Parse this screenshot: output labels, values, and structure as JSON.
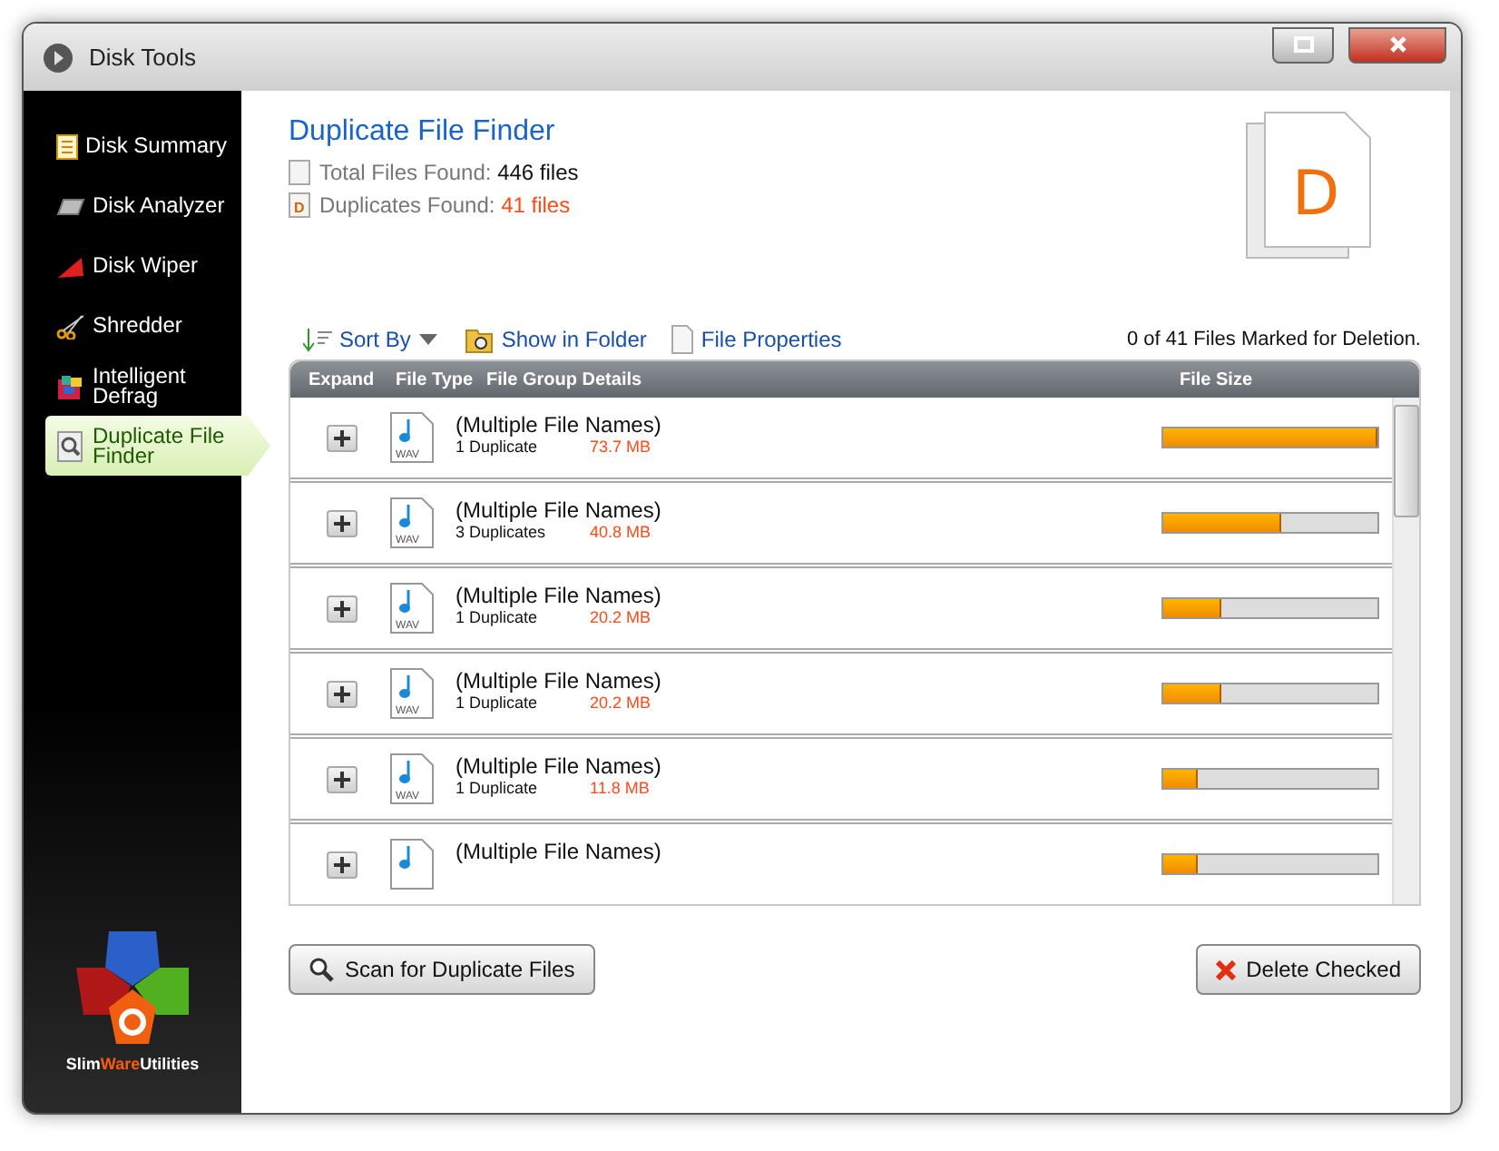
{
  "window": {
    "title": "Disk Tools"
  },
  "sidebar": {
    "items": [
      {
        "label": "Disk Summary",
        "kind": "summary",
        "selected": false
      },
      {
        "label": "Disk Analyzer",
        "kind": "analyzer",
        "selected": false
      },
      {
        "label": "Disk Wiper",
        "kind": "wiper",
        "selected": false
      },
      {
        "label": "Shredder",
        "kind": "shredder",
        "selected": false
      },
      {
        "label": "Intelligent Defrag",
        "kind": "defrag",
        "selected": false
      },
      {
        "label": "Duplicate File Finder",
        "kind": "finder",
        "selected": true
      }
    ],
    "logo_text": [
      {
        "text": "Slim",
        "accent": false
      },
      {
        "text": "Ware",
        "accent": true
      },
      {
        "text": "Utilities",
        "accent": false
      }
    ]
  },
  "page_title": "Duplicate File Finder",
  "stats": [
    {
      "label": "Total Files Found:",
      "value": "446 files",
      "kind": "total"
    },
    {
      "label": "Duplicates Found:",
      "value": "41 files",
      "kind": "duplicates",
      "icon_letter": "D"
    }
  ],
  "header_icon_letter": "D",
  "toolbar": {
    "sort": "Sort By",
    "show_in_folder": "Show in Folder",
    "file_properties": "File Properties",
    "marked": "0 of 41 Files Marked for Deletion."
  },
  "table": {
    "columns": [
      "Expand",
      "File Type",
      "File Group Details",
      "File Size"
    ],
    "rows": [
      {
        "name": "(Multiple File Names)",
        "duplicates": "1 Duplicate",
        "size": "73.7 MB",
        "type": "WAV",
        "level": 1.0
      },
      {
        "name": "(Multiple File Names)",
        "duplicates": "3 Duplicates",
        "size": "40.8 MB",
        "type": "WAV",
        "level": 0.55
      },
      {
        "name": "(Multiple File Names)",
        "duplicates": "1 Duplicate",
        "size": "20.2 MB",
        "type": "WAV",
        "level": 0.27
      },
      {
        "name": "(Multiple File Names)",
        "duplicates": "1 Duplicate",
        "size": "20.2 MB",
        "type": "WAV",
        "level": 0.27
      },
      {
        "name": "(Multiple File Names)",
        "duplicates": "1 Duplicate",
        "size": "11.8 MB",
        "type": "WAV",
        "level": 0.16
      },
      {
        "name": "(Multiple File Names)",
        "level": 0.16
      }
    ]
  },
  "buttons": {
    "scan": "Scan for Duplicate Files",
    "delete": "Delete Checked"
  }
}
